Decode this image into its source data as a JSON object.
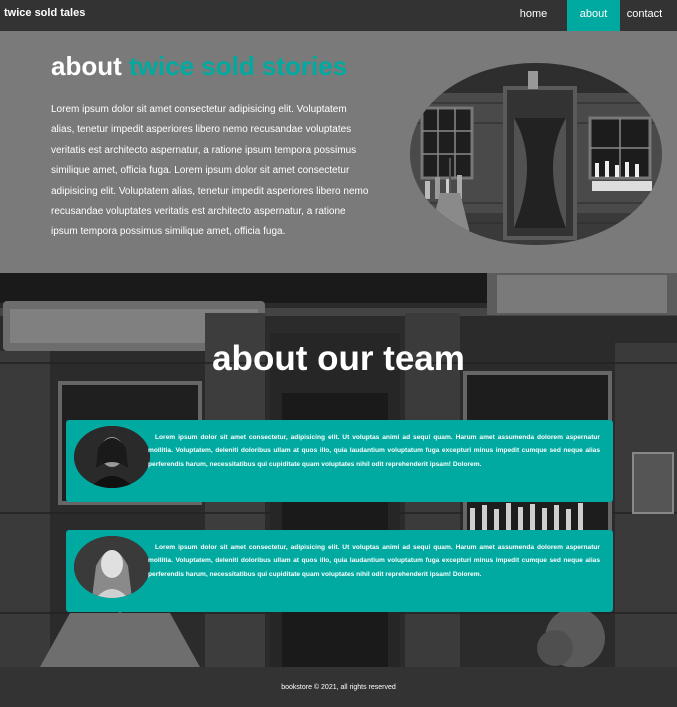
{
  "navbar": {
    "brand": "twice sold tales",
    "links": [
      {
        "label": "home"
      },
      {
        "label": "about",
        "active": true
      },
      {
        "label": "contact"
      }
    ]
  },
  "about": {
    "title_prefix": "about",
    "title_accent": "twice sold stories",
    "paragraph": "Lorem ipsum dolor sit amet consectetur adipisicing elit. Voluptatem alias, tenetur impedit asperiores libero nemo recusandae voluptates veritatis est architecto aspernatur, a ratione ipsum tempora possimus similique amet, officia fuga. Lorem ipsum dolor sit amet consectetur adipisicing elit. Voluptatem alias, tenetur impedit asperiores libero nemo recusandae voluptates veritatis est architecto aspernatur, a ratione ipsum tempora possimus similique amet, officia fuga."
  },
  "team": {
    "title": "about our team",
    "members": [
      {
        "text": "Lorem ipsum dolor sit amet consectetur, adipisicing elit. Ut voluptas animi ad sequi quam. Harum amet assumenda dolorem aspernatur mollitia. Voluptatem, deleniti doloribus ullam at quos illo, quia laudantium voluptatum fuga excepturi minus impedit cumque sed neque alias perferendis harum, necessitatibus qui cupiditate quam voluptates nihil odit reprehenderit ipsam! Dolorem."
      },
      {
        "text": "Lorem ipsum dolor sit amet consectetur, adipisicing elit. Ut voluptas animi ad sequi quam. Harum amet assumenda dolorem aspernatur mollitia. Voluptatem, deleniti doloribus ullam at quos illo, quia laudantium voluptatum fuga excepturi minus impedit cumque sed neque alias perferendis harum, necessitatibus qui cupiditate quam voluptates nihil odit reprehenderit ipsam! Dolorem."
      }
    ]
  },
  "footer": {
    "text": "bookstore © 2021, all rights reserved"
  },
  "colors": {
    "accent": "#00aaa0",
    "navbar_bg": "#333333",
    "about_bg": "#7a7a7a"
  }
}
